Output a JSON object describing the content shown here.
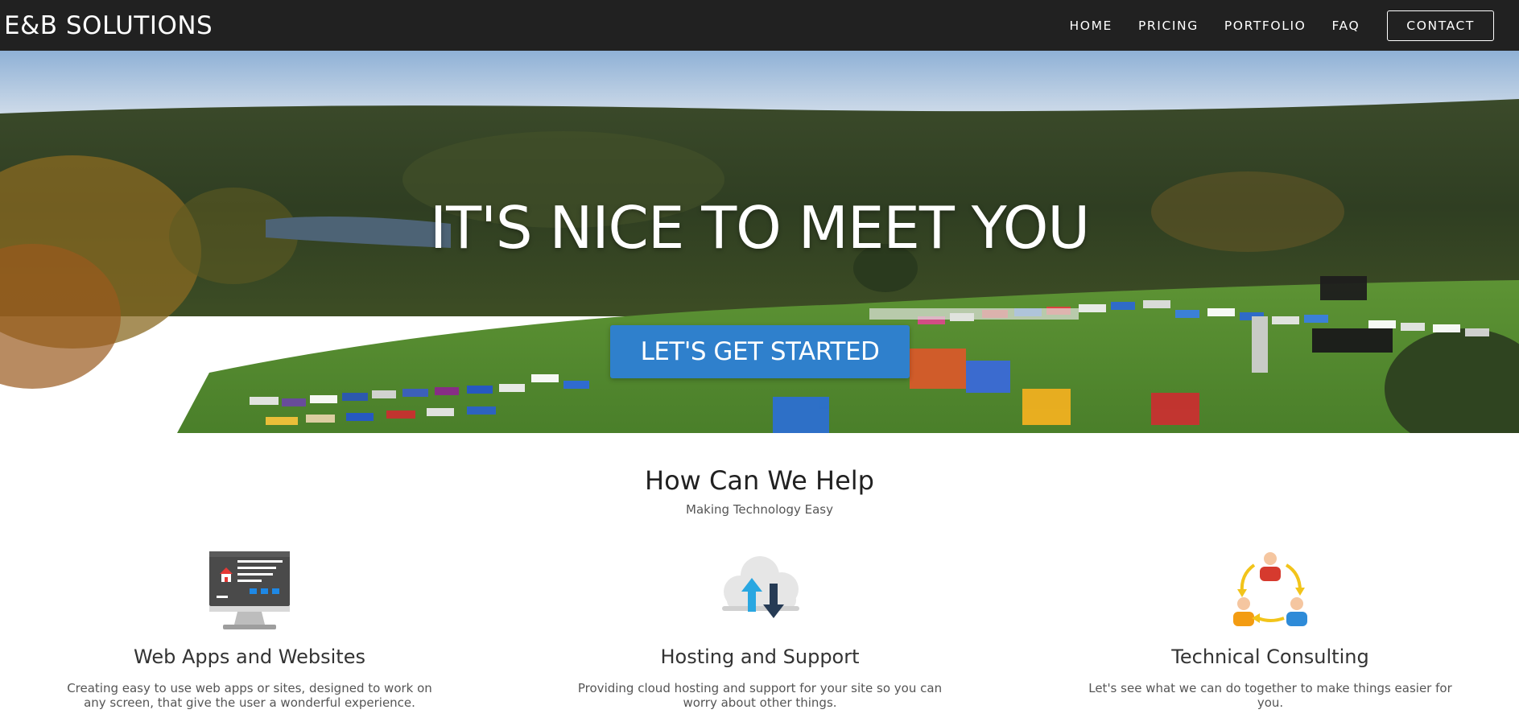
{
  "navbar": {
    "brand": "E&B SOLUTIONS",
    "links": [
      "HOME",
      "PRICING",
      "PORTFOLIO",
      "FAQ"
    ],
    "contact_label": "CONTACT"
  },
  "hero": {
    "title": "IT'S NICE TO MEET YOU",
    "cta_label": "LET'S GET STARTED"
  },
  "services_section": {
    "title": "How Can We Help",
    "subtitle": "Making Technology Easy",
    "items": [
      {
        "icon": "monitor-icon",
        "title": "Web Apps and Websites",
        "description": "Creating easy to use web apps or sites, designed to work on any screen, that give the user a wonderful experience."
      },
      {
        "icon": "cloud-upload-download-icon",
        "title": "Hosting and Support",
        "description": "Providing cloud hosting and support for your site so you can worry about other things."
      },
      {
        "icon": "team-cycle-icon",
        "title": "Technical Consulting",
        "description": "Let's see what we can do together to make things easier for you."
      }
    ]
  },
  "colors": {
    "navbar_bg": "#212121",
    "cta_bg": "#2f80cc",
    "text_dark": "#212121"
  }
}
